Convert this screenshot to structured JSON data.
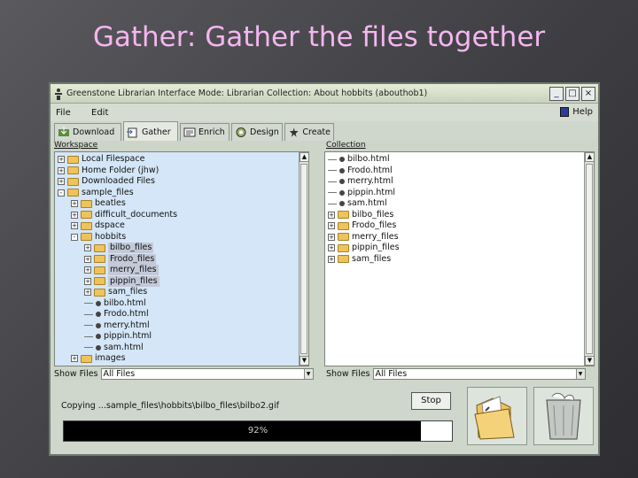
{
  "slide": {
    "title": "Gather: Gather the files together"
  },
  "window": {
    "title": "Greenstone Librarian Interface Mode: Librarian Collection: About hobbits (abouthob1)",
    "buttons": [
      "_",
      "□",
      "×"
    ]
  },
  "menu": {
    "file": "File",
    "edit": "Edit",
    "help": "Help"
  },
  "tabs": [
    {
      "label": "Download",
      "icon": "download-icon"
    },
    {
      "label": "Gather",
      "icon": "gather-icon",
      "active": true
    },
    {
      "label": "Enrich",
      "icon": "enrich-icon"
    },
    {
      "label": "Design",
      "icon": "design-icon"
    },
    {
      "label": "Create",
      "icon": "create-icon"
    }
  ],
  "workspace": {
    "header": "Workspace",
    "items": [
      {
        "label": "Local Filespace",
        "type": "folder",
        "expander": "+",
        "level": 0
      },
      {
        "label": "Home Folder (jhw)",
        "type": "folder",
        "expander": "+",
        "level": 0
      },
      {
        "label": "Downloaded Files",
        "type": "folder",
        "expander": "+",
        "level": 0
      },
      {
        "label": "sample_files",
        "type": "folder",
        "expander": "-",
        "level": 0
      },
      {
        "label": "beatles",
        "type": "folder",
        "expander": "+",
        "level": 1
      },
      {
        "label": "difficult_documents",
        "type": "folder",
        "expander": "+",
        "level": 1
      },
      {
        "label": "dspace",
        "type": "folder",
        "expander": "+",
        "level": 1
      },
      {
        "label": "hobbits",
        "type": "folder",
        "expander": "-",
        "level": 1
      },
      {
        "label": "bilbo_files",
        "type": "folder",
        "expander": "+",
        "level": 2,
        "selected": true
      },
      {
        "label": "Frodo_files",
        "type": "folder",
        "expander": "+",
        "level": 2,
        "selected": true
      },
      {
        "label": "merry_files",
        "type": "folder",
        "expander": "+",
        "level": 2,
        "selected": true
      },
      {
        "label": "pippin_files",
        "type": "folder",
        "expander": "+",
        "level": 2,
        "selected": true
      },
      {
        "label": "sam_files",
        "type": "folder",
        "expander": "+",
        "level": 2
      },
      {
        "label": "bilbo.html",
        "type": "file",
        "level": 2
      },
      {
        "label": "Frodo.html",
        "type": "file",
        "level": 2
      },
      {
        "label": "merry.html",
        "type": "file",
        "level": 2
      },
      {
        "label": "pippin.html",
        "type": "file",
        "level": 2
      },
      {
        "label": "sam.html",
        "type": "file",
        "level": 2
      },
      {
        "label": "images",
        "type": "folder",
        "expander": "+",
        "level": 1
      }
    ],
    "show_files_label": "Show Files",
    "filter": "All Files"
  },
  "collection": {
    "header": "Collection",
    "items": [
      {
        "label": "bilbo.html",
        "type": "file"
      },
      {
        "label": "Frodo.html",
        "type": "file"
      },
      {
        "label": "merry.html",
        "type": "file"
      },
      {
        "label": "pippin.html",
        "type": "file"
      },
      {
        "label": "sam.html",
        "type": "file"
      },
      {
        "label": "bilbo_files",
        "type": "folder",
        "expander": "+"
      },
      {
        "label": "Frodo_files",
        "type": "folder",
        "expander": "+"
      },
      {
        "label": "merry_files",
        "type": "folder",
        "expander": "+"
      },
      {
        "label": "pippin_files",
        "type": "folder",
        "expander": "+"
      },
      {
        "label": "sam_files",
        "type": "folder",
        "expander": "+"
      }
    ],
    "show_files_label": "Show Files",
    "filter": "All Files"
  },
  "progress": {
    "status": "Copying ...sample_files\\hobbits\\bilbo_files\\bilbo2.gif",
    "percent_label": "92%",
    "value": 0.92,
    "stop_label": "Stop"
  },
  "actions": [
    {
      "icon": "new-folder-icon"
    },
    {
      "icon": "trash-bin-icon"
    }
  ],
  "colors": {
    "title": "#f4b6f0",
    "workspace_bg": "#d4e6f7",
    "progress_fill": "#000000"
  }
}
